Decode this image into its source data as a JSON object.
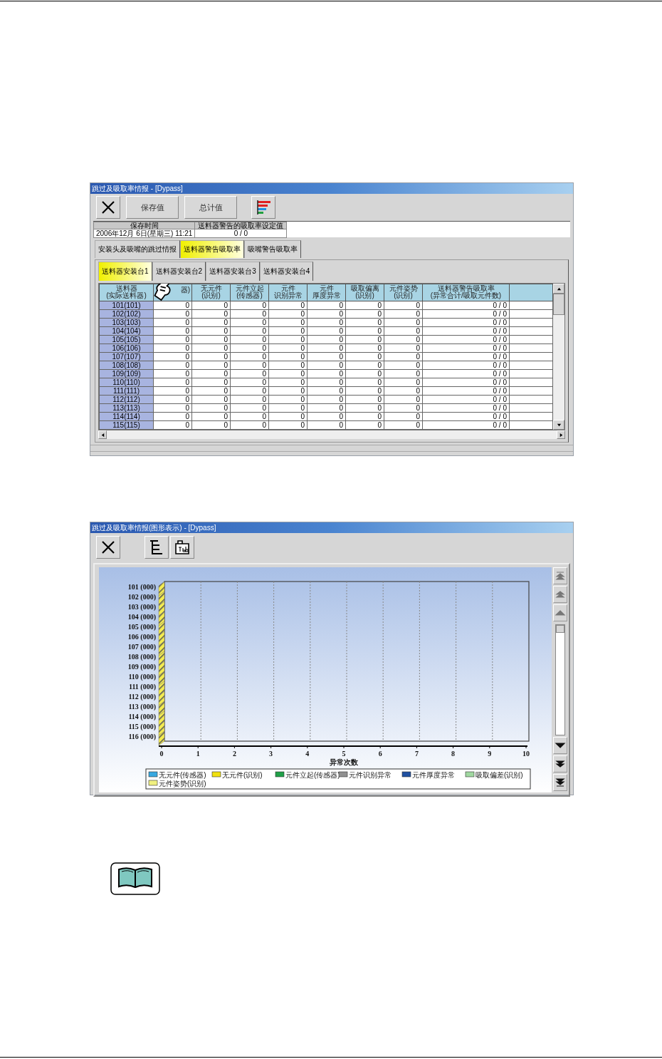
{
  "window_1": {
    "title": "跳过及吸取率情报 - [Dypass]",
    "toolbar": [
      {
        "kind": "close"
      },
      {
        "kind": "text",
        "label": "保存值"
      },
      {
        "kind": "text",
        "label": "总计值"
      },
      {
        "kind": "chart"
      }
    ],
    "info": {
      "columns": [
        "保存时间",
        "送料器警告的吸取率设定值"
      ],
      "values": [
        "2006年12月 6日(星期三) 11:21",
        "0 / 0"
      ]
    },
    "tabs": [
      {
        "label": "安装头及吸嘴的跳过情报",
        "selected": false
      },
      {
        "label": "送料器警告吸取率",
        "selected": true
      },
      {
        "label": "吸嘴警告吸取率",
        "selected": false
      }
    ],
    "subtabs": [
      {
        "label": "送料器安装台1",
        "selected": true
      },
      {
        "label": "送料器安装台2",
        "selected": false
      },
      {
        "label": "送料器安装台3",
        "selected": false
      },
      {
        "label": "送料器安装台4",
        "selected": false
      }
    ],
    "table": {
      "columns": [
        {
          "title": "送料器",
          "subtitle": "(实际送料器)"
        },
        {
          "subtitle": "器)"
        },
        {
          "title": "无元件",
          "subtitle": "(识别)"
        },
        {
          "title": "元件立起",
          "subtitle": "(传感器)"
        },
        {
          "title": "元件",
          "subtitle": "识别异常"
        },
        {
          "title": "元件",
          "subtitle": "厚度异常"
        },
        {
          "title": "吸取偏离",
          "subtitle": "(识别)"
        },
        {
          "title": "元件姿势",
          "subtitle": "(识别)"
        },
        {
          "title": "送料器警告吸取率",
          "subtitle": "(异常合计/吸取元件数)"
        }
      ],
      "rows": [
        [
          "101(101)",
          "0",
          "0",
          "0",
          "0",
          "0",
          "0",
          "0",
          "0 / 0"
        ],
        [
          "102(102)",
          "0",
          "0",
          "0",
          "0",
          "0",
          "0",
          "0",
          "0 / 0"
        ],
        [
          "103(103)",
          "0",
          "0",
          "0",
          "0",
          "0",
          "0",
          "0",
          "0 / 0"
        ],
        [
          "104(104)",
          "0",
          "0",
          "0",
          "0",
          "0",
          "0",
          "0",
          "0 / 0"
        ],
        [
          "105(105)",
          "0",
          "0",
          "0",
          "0",
          "0",
          "0",
          "0",
          "0 / 0"
        ],
        [
          "106(106)",
          "0",
          "0",
          "0",
          "0",
          "0",
          "0",
          "0",
          "0 / 0"
        ],
        [
          "107(107)",
          "0",
          "0",
          "0",
          "0",
          "0",
          "0",
          "0",
          "0 / 0"
        ],
        [
          "108(108)",
          "0",
          "0",
          "0",
          "0",
          "0",
          "0",
          "0",
          "0 / 0"
        ],
        [
          "109(109)",
          "0",
          "0",
          "0",
          "0",
          "0",
          "0",
          "0",
          "0 / 0"
        ],
        [
          "110(110)",
          "0",
          "0",
          "0",
          "0",
          "0",
          "0",
          "0",
          "0 / 0"
        ],
        [
          "111(111)",
          "0",
          "0",
          "0",
          "0",
          "0",
          "0",
          "0",
          "0 / 0"
        ],
        [
          "112(112)",
          "0",
          "0",
          "0",
          "0",
          "0",
          "0",
          "0",
          "0 / 0"
        ],
        [
          "113(113)",
          "0",
          "0",
          "0",
          "0",
          "0",
          "0",
          "0",
          "0 / 0"
        ],
        [
          "114(114)",
          "0",
          "0",
          "0",
          "0",
          "0",
          "0",
          "0",
          "0 / 0"
        ],
        [
          "115(115)",
          "0",
          "0",
          "0",
          "0",
          "0",
          "0",
          "0",
          "0 / 0"
        ]
      ]
    }
  },
  "window_2": {
    "title": "跳过及吸取率情报(图形表示) - [Dypass]",
    "toolbar": [
      {
        "kind": "close"
      },
      {
        "kind": "tree"
      },
      {
        "kind": "tab"
      }
    ],
    "chart_data": {
      "type": "bar",
      "orientation": "horizontal",
      "stacked": true,
      "xlabel": "异常次数",
      "categories": [
        "101 (000)",
        "102 (000)",
        "103 (000)",
        "104 (000)",
        "105 (000)",
        "106 (000)",
        "107 (000)",
        "108 (000)",
        "109 (000)",
        "110 (000)",
        "111 (000)",
        "112 (000)",
        "113 (000)",
        "114 (000)",
        "115 (000)",
        "116 (000)"
      ],
      "xlim": [
        0,
        10
      ],
      "xticks": [
        0,
        1,
        2,
        3,
        4,
        5,
        6,
        7,
        8,
        9,
        10
      ],
      "series": [
        {
          "name": "无元件(传感器)",
          "color": "#38a8e0",
          "values": [
            0,
            0,
            0,
            0,
            0,
            0,
            0,
            0,
            0,
            0,
            0,
            0,
            0,
            0,
            0,
            0
          ]
        },
        {
          "name": "无元件(识别)",
          "color": "#f0e010",
          "values": [
            0,
            0,
            0,
            0,
            0,
            0,
            0,
            0,
            0,
            0,
            0,
            0,
            0,
            0,
            0,
            0
          ]
        },
        {
          "name": "元件立起(传感器)",
          "color": "#20a048",
          "values": [
            0,
            0,
            0,
            0,
            0,
            0,
            0,
            0,
            0,
            0,
            0,
            0,
            0,
            0,
            0,
            0
          ]
        },
        {
          "name": "元件识别异常",
          "color": "#909090",
          "values": [
            0,
            0,
            0,
            0,
            0,
            0,
            0,
            0,
            0,
            0,
            0,
            0,
            0,
            0,
            0,
            0
          ]
        },
        {
          "name": "元件厚度异常",
          "color": "#2050a0",
          "values": [
            0,
            0,
            0,
            0,
            0,
            0,
            0,
            0,
            0,
            0,
            0,
            0,
            0,
            0,
            0,
            0
          ]
        },
        {
          "name": "吸取偏差(识别)",
          "color": "#a0d8a0",
          "values": [
            0,
            0,
            0,
            0,
            0,
            0,
            0,
            0,
            0,
            0,
            0,
            0,
            0,
            0,
            0,
            0
          ]
        },
        {
          "name": "元件姿势(识别)",
          "color": "#f0f080",
          "values": [
            0,
            0,
            0,
            0,
            0,
            0,
            0,
            0,
            0,
            0,
            0,
            0,
            0,
            0,
            0,
            0
          ]
        }
      ]
    }
  }
}
